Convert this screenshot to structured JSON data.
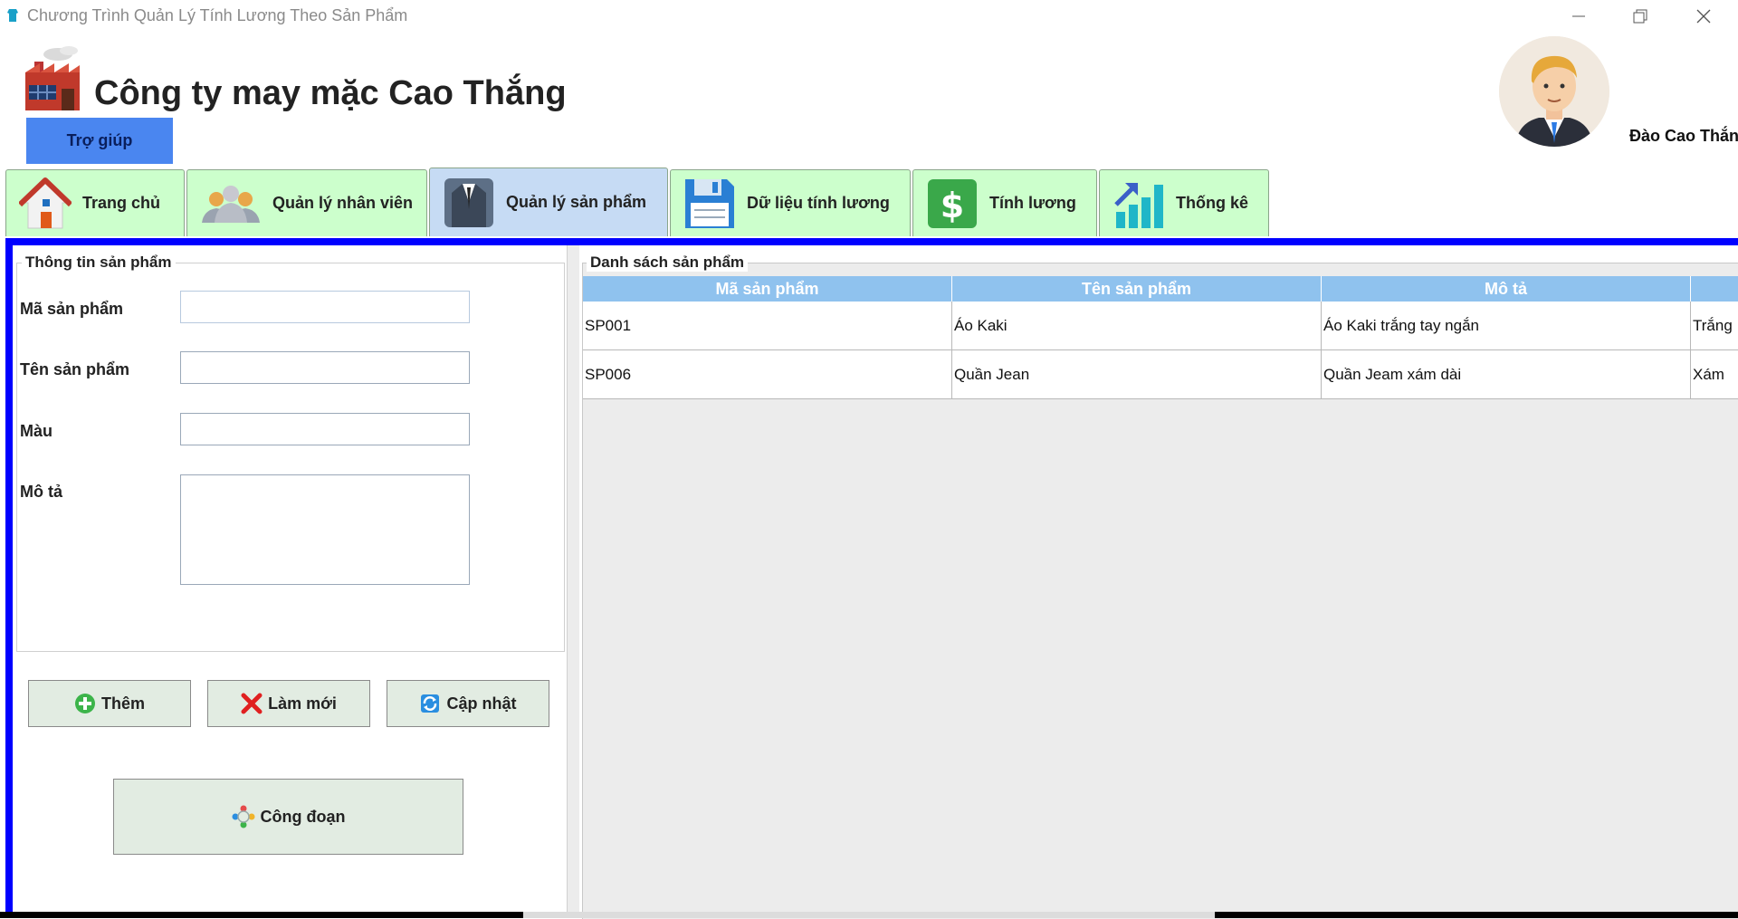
{
  "window": {
    "title": "Chương Trình Quản Lý Tính Lương Theo Sản Phẩm",
    "minimize_icon": "minimize-icon",
    "restore_icon": "restore-icon",
    "close_icon": "close-icon"
  },
  "header": {
    "company": "Công ty may mặc Cao Thắng",
    "help_label": "Trợ giúp",
    "user_name": "Đào Cao Thắng",
    "help_color": "#4a86f0"
  },
  "tabs": [
    {
      "label": "Trang chủ",
      "icon": "house-icon"
    },
    {
      "label": "Quản lý nhân viên",
      "icon": "people-icon"
    },
    {
      "label": "Quản lý sản phẩm",
      "icon": "suit-icon",
      "active": true
    },
    {
      "label": "Dữ liệu tính lương",
      "icon": "floppy-disk-icon"
    },
    {
      "label": "Tính lương",
      "icon": "dollar-icon"
    },
    {
      "label": "Thống kê",
      "icon": "bar-chart-icon"
    }
  ],
  "form": {
    "legend": "Thông tin sản phẩm",
    "fields": {
      "code_label": "Mã sản phẩm",
      "name_label": "Tên sản phẩm",
      "color_label": "Màu",
      "desc_label": "Mô tả"
    },
    "buttons": {
      "add": "Thêm",
      "reset": "Làm mới",
      "update": "Cập nhật",
      "stages": "Công đoạn"
    }
  },
  "table": {
    "legend": "Danh sách sản phẩm",
    "columns": [
      "Mã sản phẩm",
      "Tên sản phẩm",
      "Mô tả",
      ""
    ],
    "rows": [
      [
        "SP001",
        "Áo Kaki",
        "Áo Kaki trắng tay ngắn",
        "Trắng"
      ],
      [
        "SP006",
        "Quần Jean",
        "Quần Jeam xám dài",
        "Xám"
      ]
    ]
  },
  "colors": {
    "tab_bg": "#ccffcc",
    "tab_active_bg": "#c6dbf4",
    "panel_border": "#0000ff",
    "table_header": "#8fc2ee"
  }
}
